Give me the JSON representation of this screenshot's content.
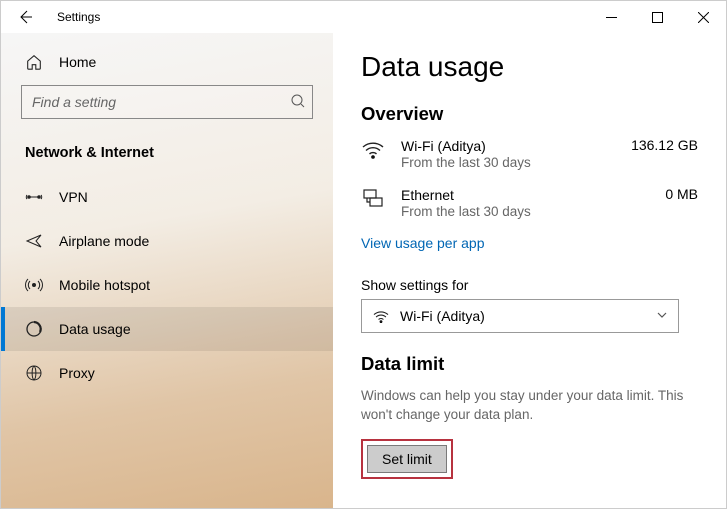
{
  "titlebar": {
    "title": "Settings"
  },
  "sidebar": {
    "home": "Home",
    "search_placeholder": "Find a setting",
    "section": "Network & Internet",
    "items": [
      {
        "label": "VPN"
      },
      {
        "label": "Airplane mode"
      },
      {
        "label": "Mobile hotspot"
      },
      {
        "label": "Data usage"
      },
      {
        "label": "Proxy"
      }
    ]
  },
  "main": {
    "title": "Data usage",
    "overview_heading": "Overview",
    "items": [
      {
        "name": "Wi-Fi (Aditya)",
        "sub": "From the last 30 days",
        "value": "136.12 GB"
      },
      {
        "name": "Ethernet",
        "sub": "From the last 30 days",
        "value": "0 MB"
      }
    ],
    "view_link": "View usage per app",
    "show_label": "Show settings for",
    "dropdown_value": "Wi-Fi (Aditya)",
    "datalimit_heading": "Data limit",
    "datalimit_desc": "Windows can help you stay under your data limit. This won't change your data plan.",
    "setlimit_label": "Set limit"
  }
}
